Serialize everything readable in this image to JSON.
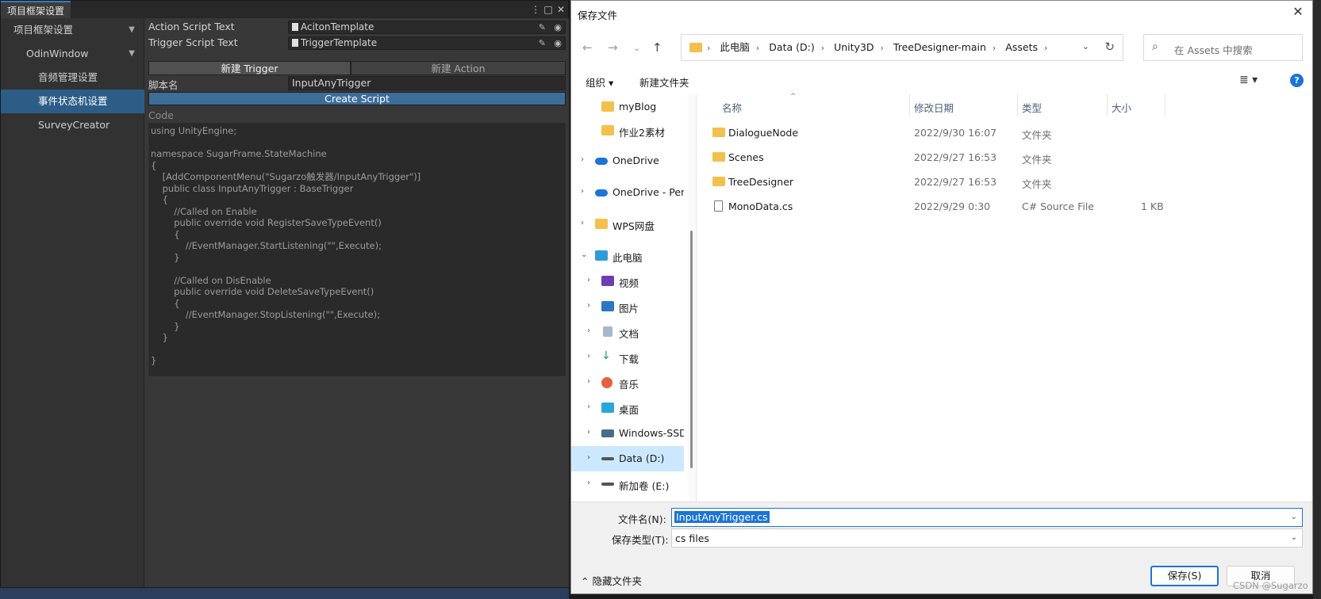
{
  "unity": {
    "tab_title": "项目框架设置",
    "sidebar": [
      {
        "label": "项目框架设置",
        "has_arrow": true
      },
      {
        "label": "OdinWindow",
        "has_arrow": true
      },
      {
        "label": "音频管理设置"
      },
      {
        "label": "事件状态机设置",
        "selected": true
      },
      {
        "label": "SurveyCreator"
      }
    ],
    "fields": [
      {
        "label": "Action Script Text",
        "value": "AcitonTemplate"
      },
      {
        "label": "Trigger Script Text",
        "value": "TriggerTemplate"
      }
    ],
    "tabs": [
      {
        "label": "新建 Trigger",
        "active": true
      },
      {
        "label": "新建 Action",
        "active": false
      }
    ],
    "script_name_label": "脚本名",
    "script_name_value": "InputAnyTrigger",
    "create_button": "Create Script",
    "code_label": "Code",
    "code_text": "using UnityEngine;\n\nnamespace SugarFrame.StateMachine\n{\n    [AddComponentMenu(\"Sugarzo触发器/InputAnyTrigger\")]\n    public class InputAnyTrigger : BaseTrigger\n    {\n        //Called on Enable\n        public override void RegisterSaveTypeEvent()\n        {\n            //EventManager.StartListening(\"\",Execute);\n        }\n\n        //Called on DisEnable\n        public override void DeleteSaveTypeEvent()\n        {\n            //EventManager.StopListening(\"\",Execute);\n        }\n    }\n\n}"
  },
  "dialog": {
    "title": "保存文件",
    "breadcrumbs": [
      "此电脑",
      "Data (D:)",
      "Unity3D",
      "TreeDesigner-main",
      "Assets"
    ],
    "search_placeholder": "在 Assets 中搜索",
    "toolbar": {
      "organize": "组织 ▾",
      "new_folder": "新建文件夹"
    },
    "tree": [
      {
        "label": "myBlog",
        "icon": "folder-icon",
        "indent": 1
      },
      {
        "label": "作业2素材",
        "icon": "folder-icon",
        "indent": 1
      },
      {
        "label": "OneDrive",
        "icon": "cloud-icon",
        "indent": 0,
        "expander": "›"
      },
      {
        "label": "OneDrive - Pers",
        "icon": "cloud-icon",
        "indent": 0,
        "expander": "›"
      },
      {
        "label": "WPS网盘",
        "icon": "folder-icon",
        "indent": 0,
        "expander": "›"
      },
      {
        "label": "此电脑",
        "icon": "pc-icon",
        "indent": 0,
        "expander": "⌄"
      },
      {
        "label": "视频",
        "icon": "video-icon",
        "indent": 1,
        "expander": "›"
      },
      {
        "label": "图片",
        "icon": "picture-icon",
        "indent": 1,
        "expander": "›"
      },
      {
        "label": "文档",
        "icon": "document-icon",
        "indent": 1,
        "expander": "›"
      },
      {
        "label": "下载",
        "icon": "download-icon",
        "indent": 1,
        "expander": "›"
      },
      {
        "label": "音乐",
        "icon": "music-icon",
        "indent": 1,
        "expander": "›"
      },
      {
        "label": "桌面",
        "icon": "desktop-icon",
        "indent": 1,
        "expander": "›"
      },
      {
        "label": "Windows-SSD",
        "icon": "drive-icon",
        "indent": 1,
        "expander": "›"
      },
      {
        "label": "Data (D:)",
        "icon": "drive-icon",
        "indent": 1,
        "expander": "›",
        "selected": true
      },
      {
        "label": "新加卷 (E:)",
        "icon": "drive-icon",
        "indent": 1,
        "expander": "›"
      }
    ],
    "columns": [
      "名称",
      "修改日期",
      "类型",
      "大小"
    ],
    "files": [
      {
        "name": "DialogueNode",
        "date": "2022/9/30 16:07",
        "type": "文件夹",
        "size": "",
        "kind": "folder"
      },
      {
        "name": "Scenes",
        "date": "2022/9/27 16:53",
        "type": "文件夹",
        "size": "",
        "kind": "folder"
      },
      {
        "name": "TreeDesigner",
        "date": "2022/9/27 16:53",
        "type": "文件夹",
        "size": "",
        "kind": "folder"
      },
      {
        "name": "MonoData.cs",
        "date": "2022/9/29 0:30",
        "type": "C# Source File",
        "size": "1 KB",
        "kind": "file"
      }
    ],
    "filename_label": "文件名(N):",
    "filename_value": "InputAnyTrigger.cs",
    "filetype_label": "保存类型(T):",
    "filetype_value": "cs files",
    "hide_folders": "隐藏文件夹",
    "save_button": "保存(S)",
    "cancel_button": "取消"
  },
  "watermark": "CSDN @Sugarzo"
}
